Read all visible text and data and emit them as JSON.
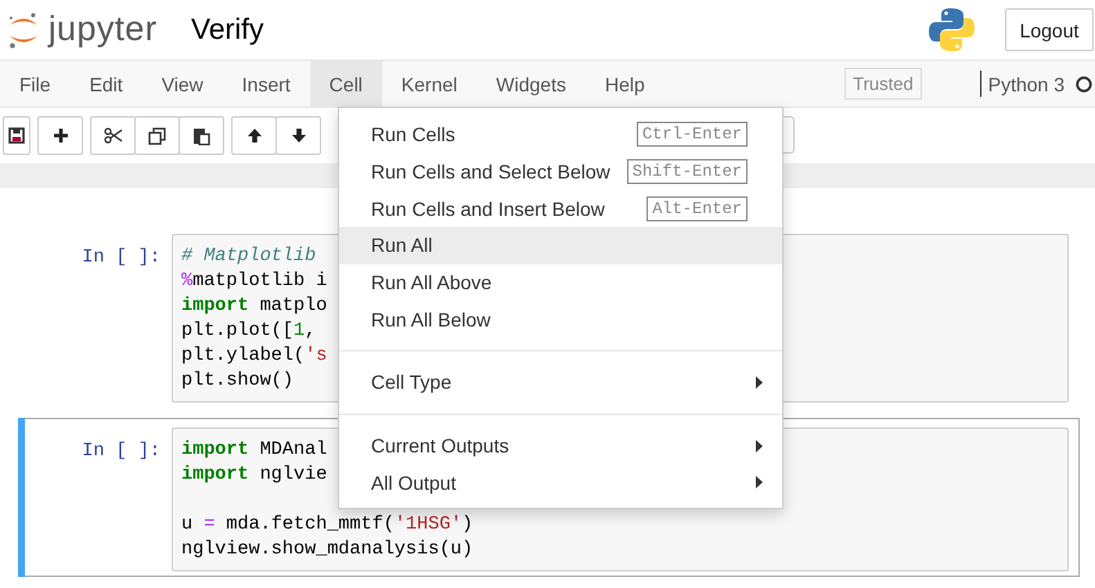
{
  "header": {
    "logo_text": "jupyter",
    "title": "Verify",
    "logout": "Logout"
  },
  "menubar": {
    "items": [
      {
        "label": "File",
        "selected": false
      },
      {
        "label": "Edit",
        "selected": false
      },
      {
        "label": "View",
        "selected": false
      },
      {
        "label": "Insert",
        "selected": false
      },
      {
        "label": "Cell",
        "selected": true
      },
      {
        "label": "Kernel",
        "selected": false
      },
      {
        "label": "Widgets",
        "selected": false
      },
      {
        "label": "Help",
        "selected": false
      }
    ],
    "trusted": "Trusted",
    "kernel": "Python 3"
  },
  "toolbar": {
    "groups": [
      {
        "buttons": [
          {
            "kind": "save"
          }
        ]
      },
      {
        "buttons": [
          {
            "kind": "add"
          }
        ]
      },
      {
        "buttons": [
          {
            "kind": "cut"
          },
          {
            "kind": "copy"
          },
          {
            "kind": "paste"
          }
        ]
      },
      {
        "buttons": [
          {
            "kind": "up"
          },
          {
            "kind": "down"
          }
        ]
      }
    ]
  },
  "cells": [
    {
      "prompt": "In [ ]:",
      "selected": false,
      "lines": [
        {
          "tokens": [
            {
              "text": "# Matplotlib",
              "kind": "comment"
            }
          ]
        },
        {
          "tokens": [
            {
              "text": "%",
              "kind": "magic"
            },
            {
              "text": "matplotlib i",
              "kind": "plain"
            }
          ]
        },
        {
          "tokens": [
            {
              "text": "import",
              "kind": "keyword"
            },
            {
              "text": " matplo",
              "kind": "plain"
            }
          ]
        },
        {
          "tokens": [
            {
              "text": "plt.plot([",
              "kind": "plain"
            },
            {
              "text": "1",
              "kind": "number"
            },
            {
              "text": ",",
              "kind": "plain"
            }
          ]
        },
        {
          "tokens": [
            {
              "text": "plt.ylabel(",
              "kind": "plain"
            },
            {
              "text": "'s",
              "kind": "string"
            }
          ]
        },
        {
          "tokens": [
            {
              "text": "plt.show()",
              "kind": "plain"
            }
          ]
        }
      ]
    },
    {
      "prompt": "In [ ]:",
      "selected": true,
      "lines": [
        {
          "tokens": [
            {
              "text": "import",
              "kind": "keyword"
            },
            {
              "text": " MDAnal",
              "kind": "plain"
            }
          ]
        },
        {
          "tokens": [
            {
              "text": "import",
              "kind": "keyword"
            },
            {
              "text": " nglvie",
              "kind": "plain"
            }
          ]
        },
        {
          "gap_before": true,
          "tokens": [
            {
              "text": "u ",
              "kind": "plain"
            },
            {
              "text": "=",
              "kind": "operator"
            },
            {
              "text": " mda.fetch_mmtf(",
              "kind": "plain"
            },
            {
              "text": "'1HSG'",
              "kind": "string"
            },
            {
              "text": ")",
              "kind": "plain"
            }
          ]
        },
        {
          "tokens": [
            {
              "text": "nglview.show_mdanalysis(u)",
              "kind": "plain"
            }
          ]
        }
      ]
    }
  ],
  "cell_menu": {
    "sections": [
      {
        "items": [
          {
            "label": "Run Cells",
            "shortcut": "Ctrl-Enter",
            "submenu": false,
            "selected": false
          },
          {
            "label": "Run Cells and Select Below",
            "shortcut": "Shift-Enter",
            "submenu": false,
            "selected": false
          },
          {
            "label": "Run Cells and Insert Below",
            "shortcut": "Alt-Enter",
            "submenu": false,
            "selected": false
          },
          {
            "label": "Run All",
            "submenu": false,
            "selected": true
          },
          {
            "label": "Run All Above",
            "submenu": false,
            "selected": false
          },
          {
            "label": "Run All Below",
            "submenu": false,
            "selected": false
          }
        ]
      },
      {
        "items": [
          {
            "label": "Cell Type",
            "submenu": true,
            "selected": false
          }
        ]
      },
      {
        "items": [
          {
            "label": "Current Outputs",
            "submenu": true,
            "selected": false
          },
          {
            "label": "All Output",
            "submenu": true,
            "selected": false
          }
        ]
      }
    ]
  }
}
